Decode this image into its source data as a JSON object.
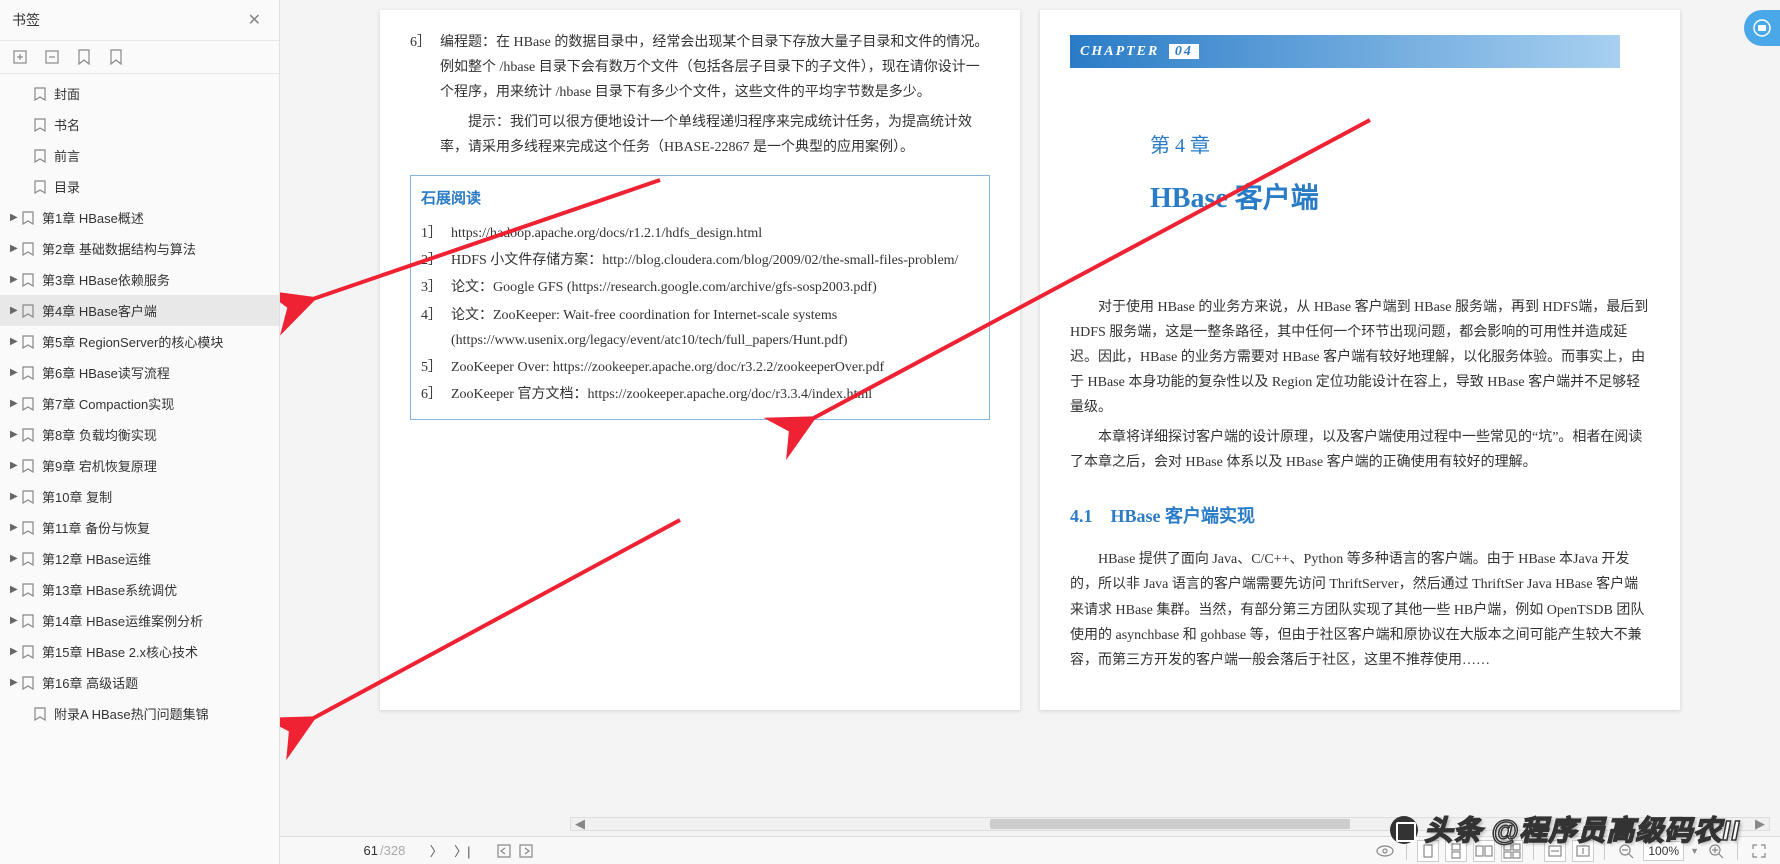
{
  "sidebar": {
    "title": "书签",
    "items": [
      {
        "label": "封面",
        "hasChildren": false,
        "indent": 1
      },
      {
        "label": "书名",
        "hasChildren": false,
        "indent": 1
      },
      {
        "label": "前言",
        "hasChildren": false,
        "indent": 1
      },
      {
        "label": "目录",
        "hasChildren": false,
        "indent": 1,
        "selected": false
      },
      {
        "label": "第1章 HBase概述",
        "hasChildren": true,
        "indent": 0
      },
      {
        "label": "第2章 基础数据结构与算法",
        "hasChildren": true,
        "indent": 0
      },
      {
        "label": "第3章 HBase依赖服务",
        "hasChildren": true,
        "indent": 0
      },
      {
        "label": "第4章 HBase客户端",
        "hasChildren": true,
        "indent": 0,
        "selected": true
      },
      {
        "label": "第5章 RegionServer的核心模块",
        "hasChildren": true,
        "indent": 0
      },
      {
        "label": "第6章 HBase读写流程",
        "hasChildren": true,
        "indent": 0
      },
      {
        "label": "第7章 Compaction实现",
        "hasChildren": true,
        "indent": 0
      },
      {
        "label": "第8章 负载均衡实现",
        "hasChildren": true,
        "indent": 0
      },
      {
        "label": "第9章 宕机恢复原理",
        "hasChildren": true,
        "indent": 0
      },
      {
        "label": "第10章 复制",
        "hasChildren": true,
        "indent": 0
      },
      {
        "label": "第11章 备份与恢复",
        "hasChildren": true,
        "indent": 0
      },
      {
        "label": "第12章 HBase运维",
        "hasChildren": true,
        "indent": 0
      },
      {
        "label": "第13章 HBase系统调优",
        "hasChildren": true,
        "indent": 0
      },
      {
        "label": "第14章 HBase运维案例分析",
        "hasChildren": true,
        "indent": 0
      },
      {
        "label": "第15章 HBase 2.x核心技术",
        "hasChildren": true,
        "indent": 0
      },
      {
        "label": "第16章 高级话题",
        "hasChildren": true,
        "indent": 0
      },
      {
        "label": "附录A   HBase热门问题集锦",
        "hasChildren": false,
        "indent": 1
      }
    ]
  },
  "leftPage": {
    "exercise": {
      "num": "6］",
      "text": "编程题：在 HBase 的数据目录中，经常会出现某个目录下存放大量子目录和文件的情况。例如整个 /hbase 目录下会有数万个文件（包括各层子目录下的子文件），现在请你设计一个程序，用来统计 /hbase 目录下有多少个文件，这些文件的平均字节数是多少。",
      "hint": "提示：我们可以很方便地设计一个单线程递归程序来完成统计任务，为提高统计效率，请采用多线程来完成这个任务（HBASE-22867 是一个典型的应用案例）。"
    },
    "reading": {
      "title": "石展阅读",
      "items": [
        {
          "num": "1］",
          "text": "https://hadoop.apache.org/docs/r1.2.1/hdfs_design.html"
        },
        {
          "num": "2］",
          "text": "HDFS 小文件存储方案：http://blog.cloudera.com/blog/2009/02/the-small-files-problem/"
        },
        {
          "num": "3］",
          "text": "论文：Google GFS (https://research.google.com/archive/gfs-sosp2003.pdf)"
        },
        {
          "num": "4］",
          "text": "论文：ZooKeeper: Wait-free coordination for Internet-scale systems (https://www.usenix.org/legacy/event/atc10/tech/full_papers/Hunt.pdf)"
        },
        {
          "num": "5］",
          "text": "ZooKeeper Over: https://zookeeper.apache.org/doc/r3.2.2/zookeeperOver.pdf"
        },
        {
          "num": "6］",
          "text": "ZooKeeper 官方文档：https://zookeeper.apache.org/doc/r3.3.4/index.html"
        }
      ]
    }
  },
  "rightPage": {
    "bannerLabel": "CHAPTER",
    "bannerNum": "04",
    "chapterSmall": "第 4 章",
    "chapterBig": "HBase 客户端",
    "para1": "对于使用 HBase 的业务方来说，从 HBase 客户端到 HBase 服务端，再到 HDFS端，最后到 HDFS 服务端，这是一整条路径，其中任何一个环节出现问题，都会影响的可用性并造成延迟。因此，HBase 的业务方需要对 HBase 客户端有较好地理解，以化服务体验。而事实上，由于 HBase 本身功能的复杂性以及 Region 定位功能设计在容上，导致 HBase 客户端并不足够轻量级。",
    "para2": "本章将详细探讨客户端的设计原理，以及客户端使用过程中一些常见的“坑”。相者在阅读了本章之后，会对 HBase 体系以及 HBase 客户端的正确使用有较好的理解。",
    "sectionTitle": "4.1　HBase 客户端实现",
    "para3": "HBase 提供了面向 Java、C/C++、Python 等多种语言的客户端。由于 HBase 本Java 开发的，所以非 Java 语言的客户端需要先访问 ThriftServer，然后通过 ThriftSer Java HBase 客户端来请求 HBase 集群。当然，有部分第三方团队实现了其他一些 HB户端，例如 OpenTSDB 团队使用的 asynchbase 和 gohbase 等，但由于社区客户端和原协议在大版本之间可能产生较大不兼容，而第三方开发的客户端一般会落后于社区，这里不推荐使用……"
  },
  "footer": {
    "currentPage": "61",
    "totalPages": "/328",
    "zoom": "100%"
  },
  "watermark": "头条 @程序员高级码农II"
}
